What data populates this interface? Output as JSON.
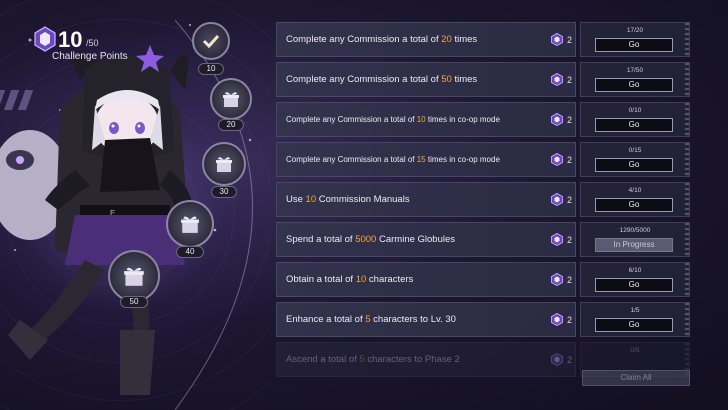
{
  "challenge": {
    "points": "10",
    "max": "/50",
    "label": "Challenge Points"
  },
  "milestones": [
    {
      "value": "10",
      "state": "claimed",
      "icon": "check-icon"
    },
    {
      "value": "20",
      "state": "locked",
      "icon": "gift-icon"
    },
    {
      "value": "30",
      "state": "locked",
      "icon": "gift-icon"
    },
    {
      "value": "40",
      "state": "locked",
      "icon": "gift-icon"
    },
    {
      "value": "50",
      "state": "locked",
      "icon": "gift-icon"
    }
  ],
  "tasks": [
    {
      "pre": "Complete any Commission a total of ",
      "num": "20",
      "post": " times",
      "reward": "2",
      "progress": "17/20",
      "button": "Go",
      "small": false
    },
    {
      "pre": "Complete any Commission a total of ",
      "num": "50",
      "post": " times",
      "reward": "2",
      "progress": "17/50",
      "button": "Go",
      "small": false
    },
    {
      "pre": "Complete any Commission a total of ",
      "num": "10",
      "post": " times in co-op mode",
      "reward": "2",
      "progress": "0/10",
      "button": "Go",
      "small": true
    },
    {
      "pre": "Complete any Commission a total of ",
      "num": "15",
      "post": " times in co-op mode",
      "reward": "2",
      "progress": "0/15",
      "button": "Go",
      "small": true
    },
    {
      "pre": "Use ",
      "num": "10",
      "post": " Commission Manuals",
      "reward": "2",
      "progress": "4/10",
      "button": "Go",
      "small": false
    },
    {
      "pre": "Spend a total of ",
      "num": "5000",
      "post": " Carmine Globules",
      "reward": "2",
      "progress": "1290/5000",
      "button": "In Progress",
      "small": false
    },
    {
      "pre": "Obtain a total of ",
      "num": "10",
      "post": " characters",
      "reward": "2",
      "progress": "6/10",
      "button": "Go",
      "small": false
    },
    {
      "pre": "Enhance a total of ",
      "num": "5",
      "post": " characters to Lv. 30",
      "reward": "2",
      "progress": "1/5",
      "button": "Go",
      "small": false
    },
    {
      "pre": "Ascend a total of ",
      "num": "5",
      "post": " characters to Phase 2",
      "reward": "2",
      "progress": "0/5",
      "button": "",
      "small": false
    }
  ],
  "claim_all": "Claim All",
  "colors": {
    "highlight": "#f1a53c",
    "accent": "#9a6cf0"
  }
}
